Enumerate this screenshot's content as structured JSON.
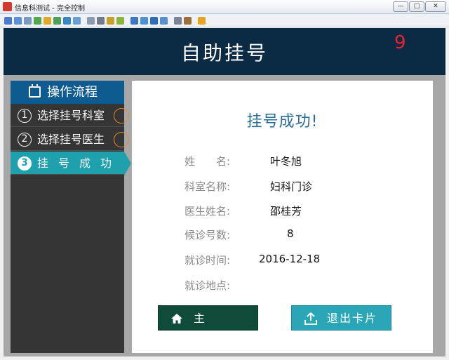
{
  "window": {
    "title": "信息科测试 - 完全控制",
    "min_label": "—",
    "max_label": "□",
    "close_label": "✕"
  },
  "header": {
    "title": "自助挂号",
    "counter": "9"
  },
  "sidebar": {
    "title": "操作流程",
    "steps": [
      {
        "num": "1",
        "label": "选择挂号科室"
      },
      {
        "num": "2",
        "label": "选择挂号医生"
      },
      {
        "num": "3",
        "label": "挂号成功"
      }
    ]
  },
  "main": {
    "title": "挂号成功!",
    "fields": [
      {
        "label": "姓　　名:",
        "value": "叶冬旭"
      },
      {
        "label": "科室名称:",
        "value": "妇科门诊"
      },
      {
        "label": "医生姓名:",
        "value": "邵桂芳"
      },
      {
        "label": "候诊号数:",
        "value": "8"
      },
      {
        "label": "就诊时间:",
        "value": "2016-12-18"
      },
      {
        "label": "就诊地点:",
        "value": ""
      }
    ],
    "home_button": "主页",
    "exit_button": "退出卡片"
  },
  "colors": {
    "header_bg": "#0b2a44",
    "active_step": "#1fa1ad",
    "title_blue": "#2c6d98",
    "counter_red": "#e8232f"
  }
}
